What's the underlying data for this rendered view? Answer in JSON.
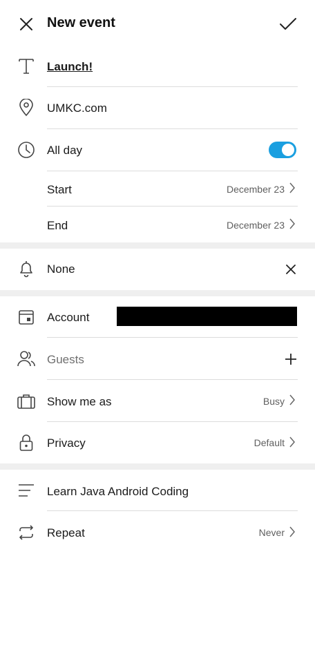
{
  "header": {
    "title": "New event"
  },
  "event": {
    "title": "Launch!",
    "location": "UMKC.com"
  },
  "all_day": {
    "label": "All day",
    "on": true,
    "accent": "#1a9fe0"
  },
  "start": {
    "label": "Start",
    "value": "December 23"
  },
  "end": {
    "label": "End",
    "value": "December 23"
  },
  "reminder": {
    "label": "None"
  },
  "account": {
    "label": "Account"
  },
  "guests": {
    "placeholder": "Guests"
  },
  "show_as": {
    "label": "Show me as",
    "value": "Busy"
  },
  "privacy": {
    "label": "Privacy",
    "value": "Default"
  },
  "description": {
    "text": "Learn Java Android Coding"
  },
  "repeat": {
    "label": "Repeat",
    "value": "Never"
  },
  "icons": [
    "close-icon",
    "check-icon",
    "text-icon",
    "location-pin-icon",
    "clock-icon",
    "bell-icon",
    "calendar-icon",
    "person-icon",
    "plus-icon",
    "briefcase-icon",
    "lock-icon",
    "notes-icon",
    "repeat-icon",
    "chevron-right-icon"
  ]
}
